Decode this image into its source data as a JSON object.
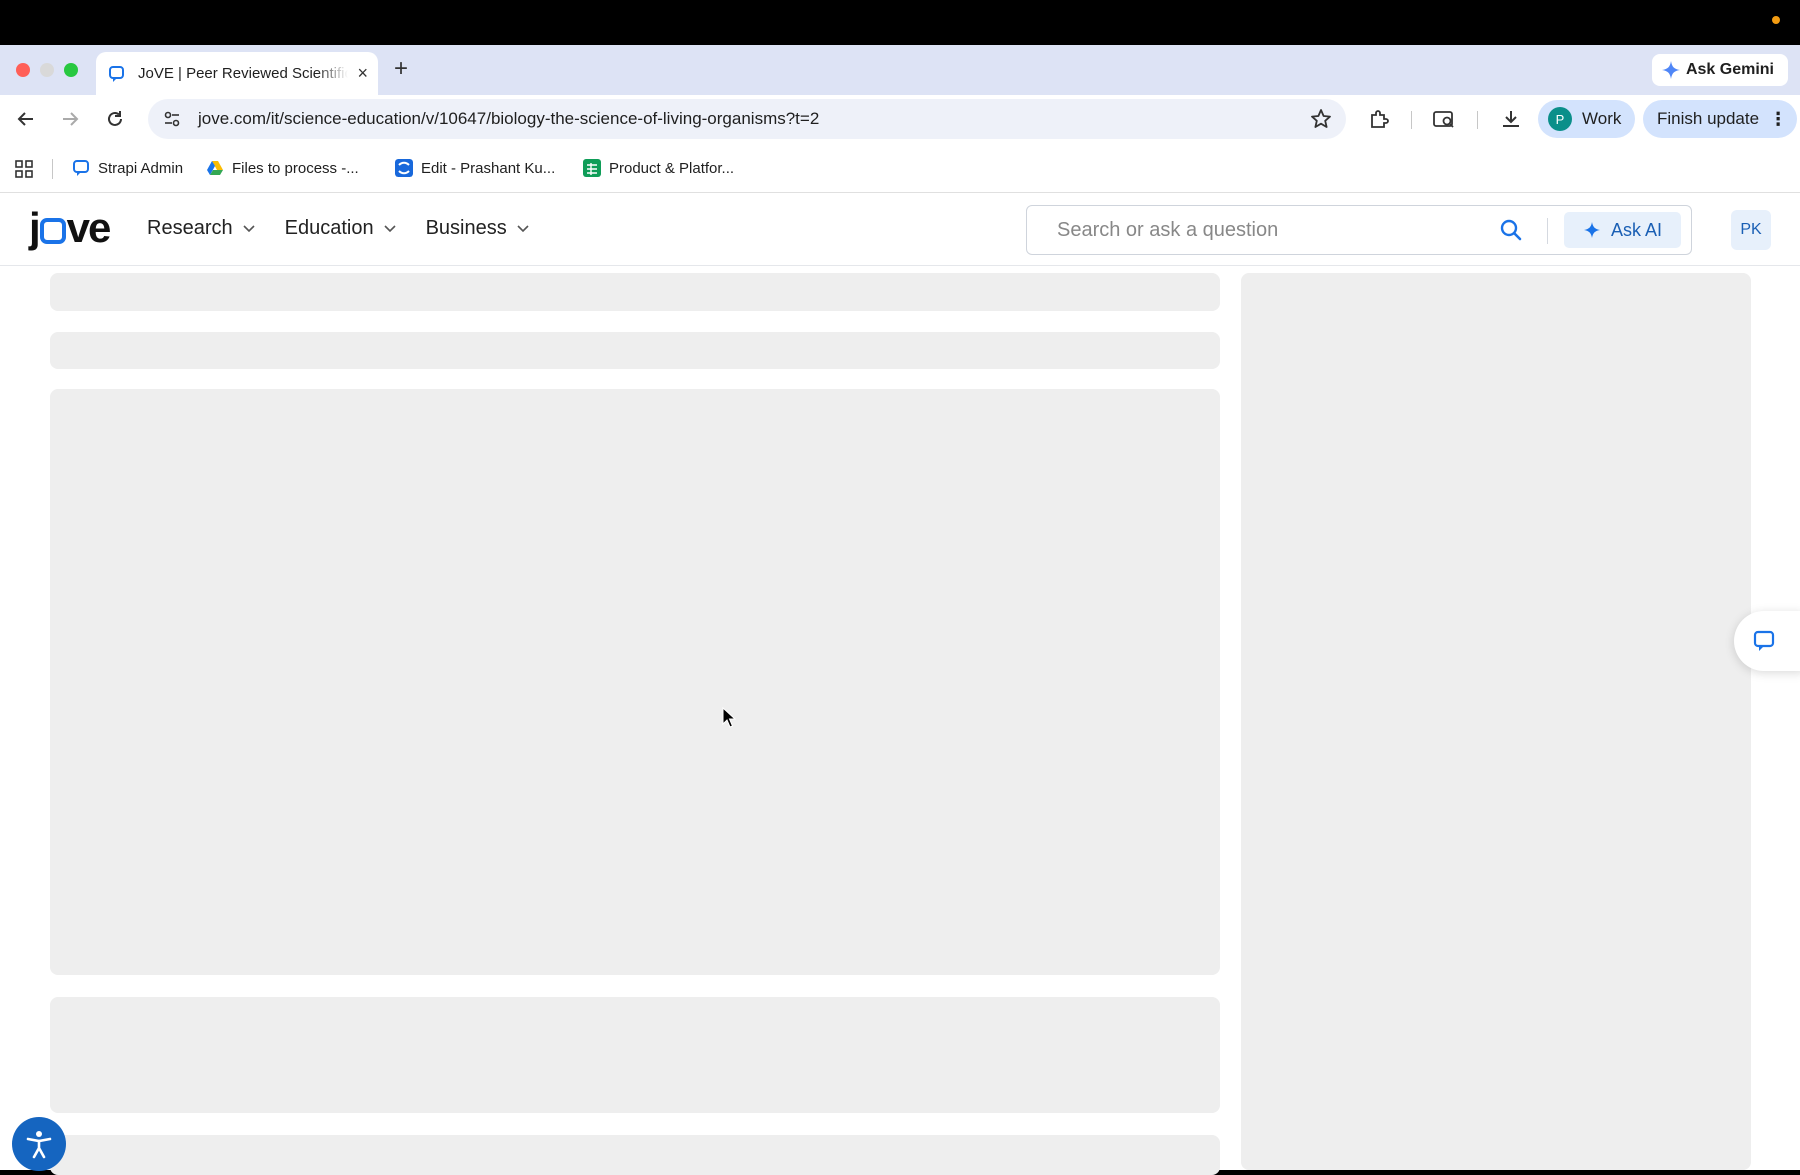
{
  "browser": {
    "tab_title": "JoVE | Peer Reviewed Scientific",
    "new_tab_symbol": "+",
    "close_symbol": "×",
    "ask_gemini_label": "Ask Gemini",
    "url": "jove.com/it/science-education/v/10647/biology-the-science-of-living-organisms?t=2",
    "profile_initial": "P",
    "profile_label": "Work",
    "finish_update_label": "Finish update",
    "kebab": "⋮"
  },
  "bookmarks": [
    {
      "label": "Strapi Admin",
      "icon": "chat-bubble-icon",
      "color": "#1a73e8"
    },
    {
      "label": "Files to process -...",
      "icon": "google-drive-icon",
      "color": "#34a853"
    },
    {
      "label": "Edit - Prashant Ku...",
      "icon": "confluence-icon",
      "color": "#1868db"
    },
    {
      "label": "Product & Platfor...",
      "icon": "google-sheets-icon",
      "color": "#0f9d58"
    }
  ],
  "site": {
    "logo_left": "j",
    "logo_right": "ve",
    "nav": [
      {
        "label": "Research"
      },
      {
        "label": "Education"
      },
      {
        "label": "Business"
      }
    ],
    "search_placeholder": "Search or ask a question",
    "ask_ai_label": "Ask AI",
    "user_initials": "PK",
    "brand_color": "#1a73e8"
  }
}
